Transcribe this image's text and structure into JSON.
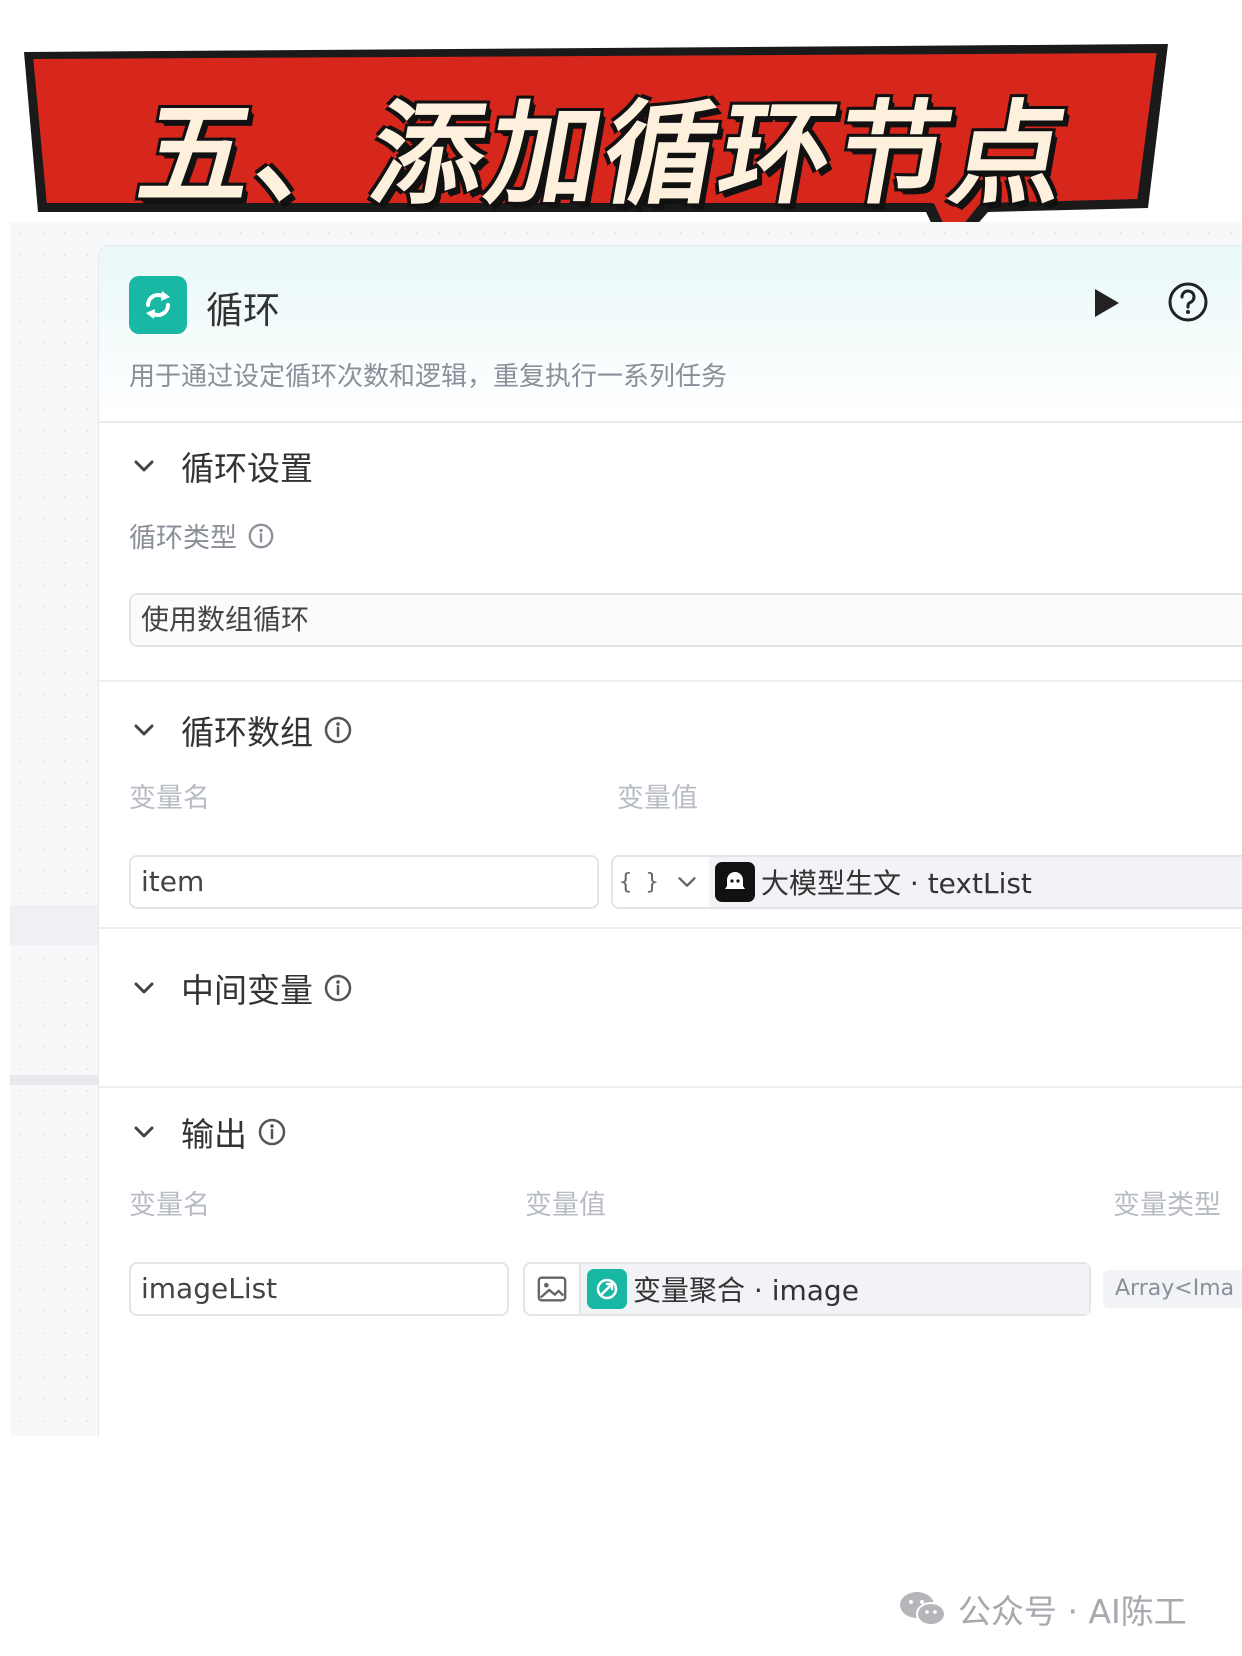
{
  "banner": {
    "title": "五、添加循环节点",
    "bg_color": "#d7261c"
  },
  "node": {
    "title": "循环",
    "description": "用于通过设定循环次数和逻辑，重复执行一系列任务",
    "accent": "#19b8a4"
  },
  "loop_settings": {
    "title": "循环设置",
    "type_label": "循环类型",
    "type_value": "使用数组循环"
  },
  "loop_array": {
    "title": "循环数组",
    "col_name": "变量名",
    "col_value": "变量值",
    "var_name": "item",
    "type_icon": "{ }",
    "ref_source": "大模型生文 · textList"
  },
  "intermediate": {
    "title": "中间变量"
  },
  "output": {
    "title": "输出",
    "col_name": "变量名",
    "col_value": "变量值",
    "col_type": "变量类型",
    "var_name": "imageList",
    "ref_source": "变量聚合 · image",
    "var_type": "Array<Ima"
  },
  "watermark": {
    "text": "公众号 · AI陈工"
  }
}
